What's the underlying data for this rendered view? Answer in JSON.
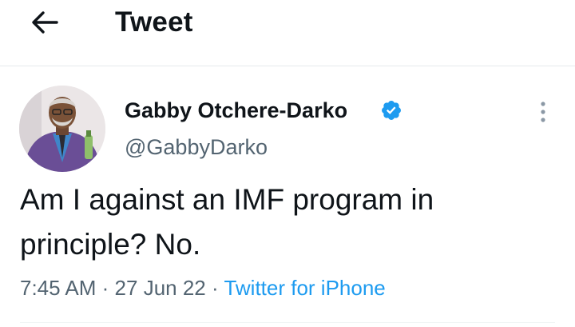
{
  "header": {
    "title": "Tweet",
    "back_icon": "arrow-left-icon"
  },
  "tweet": {
    "author_name": "Gabby Otchere-Darko",
    "handle": "@GabbyDarko",
    "verified_icon": "verified-badge-icon",
    "more_icon": "more-vertical-icon",
    "text": "Am I against an IMF program in principle? No.",
    "time": "7:45 AM",
    "separator": "·",
    "date": "27 Jun 22",
    "source": "Twitter for iPhone"
  },
  "colors": {
    "accent": "#1d9bf0",
    "text": "#0f1419",
    "muted": "#536471",
    "border": "#e6e9ec"
  }
}
